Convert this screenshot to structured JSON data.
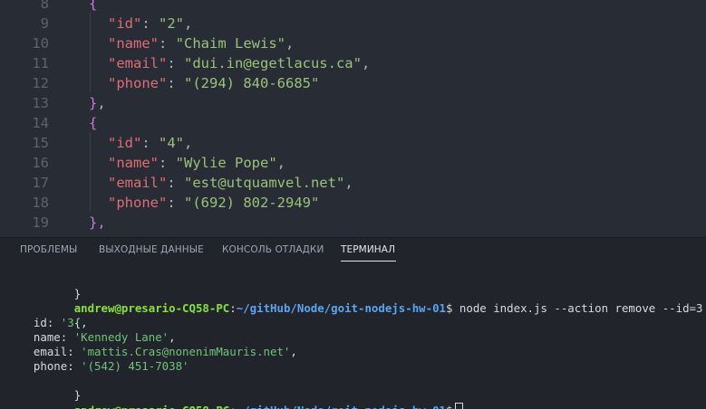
{
  "editor": {
    "lines": [
      {
        "num": "8",
        "tokens": [
          {
            "t": "{",
            "c": "brace"
          }
        ]
      },
      {
        "num": "9",
        "tokens": [
          {
            "t": "\"id\"",
            "c": "key"
          },
          {
            "t": ": ",
            "c": "punc"
          },
          {
            "t": "\"2\"",
            "c": "str"
          },
          {
            "t": ",",
            "c": "punc"
          }
        ]
      },
      {
        "num": "10",
        "tokens": [
          {
            "t": "\"name\"",
            "c": "key"
          },
          {
            "t": ": ",
            "c": "punc"
          },
          {
            "t": "\"Chaim Lewis\"",
            "c": "str"
          },
          {
            "t": ",",
            "c": "punc"
          }
        ]
      },
      {
        "num": "11",
        "tokens": [
          {
            "t": "\"email\"",
            "c": "key"
          },
          {
            "t": ": ",
            "c": "punc"
          },
          {
            "t": "\"dui.in@egetlacus.ca\"",
            "c": "str"
          },
          {
            "t": ",",
            "c": "punc"
          }
        ]
      },
      {
        "num": "12",
        "tokens": [
          {
            "t": "\"phone\"",
            "c": "key"
          },
          {
            "t": ": ",
            "c": "punc"
          },
          {
            "t": "\"(294) 840-6685\"",
            "c": "str"
          }
        ]
      },
      {
        "num": "13",
        "tokens": [
          {
            "t": "}",
            "c": "brace"
          },
          {
            "t": ",",
            "c": "punc"
          }
        ]
      },
      {
        "num": "14",
        "tokens": [
          {
            "t": "{",
            "c": "brace"
          }
        ]
      },
      {
        "num": "15",
        "tokens": [
          {
            "t": "\"id\"",
            "c": "key"
          },
          {
            "t": ": ",
            "c": "punc"
          },
          {
            "t": "\"4\"",
            "c": "str"
          },
          {
            "t": ",",
            "c": "punc"
          }
        ]
      },
      {
        "num": "16",
        "tokens": [
          {
            "t": "\"name\"",
            "c": "key"
          },
          {
            "t": ": ",
            "c": "punc"
          },
          {
            "t": "\"Wylie Pope\"",
            "c": "str"
          },
          {
            "t": ",",
            "c": "punc"
          }
        ]
      },
      {
        "num": "17",
        "tokens": [
          {
            "t": "\"email\"",
            "c": "key"
          },
          {
            "t": ": ",
            "c": "punc"
          },
          {
            "t": "\"est@utquamvel.net\"",
            "c": "str"
          },
          {
            "t": ",",
            "c": "punc"
          }
        ]
      },
      {
        "num": "18",
        "tokens": [
          {
            "t": "\"phone\"",
            "c": "key"
          },
          {
            "t": ": ",
            "c": "punc"
          },
          {
            "t": "\"(692) 802-2949\"",
            "c": "str"
          }
        ]
      },
      {
        "num": "19",
        "tokens": [
          {
            "t": "},",
            "c": "brace"
          }
        ]
      }
    ]
  },
  "panel": {
    "tabs": [
      {
        "label": "ПРОБЛЕМЫ",
        "active": false
      },
      {
        "label": "ВЫХОДНЫЕ ДАННЫЕ",
        "active": false
      },
      {
        "label": "КОНСОЛЬ ОТЛАДКИ",
        "active": false
      },
      {
        "label": "ТЕРМИНАЛ",
        "active": true
      }
    ]
  },
  "terminal": {
    "prompt_user": "andrew@presario-CQ58-PC",
    "prompt_sep": ":",
    "prompt_path": "~/gitHub/Node/goit-nodejs-hw-01",
    "prompt_dollar": "$",
    "command": " node index.js --action remove --id=3",
    "pre_line": "}",
    "open_brace": "{",
    "close_brace": "}",
    "record": [
      {
        "key": "  id: ",
        "value": "'3'",
        "suffix": ","
      },
      {
        "key": "  name: ",
        "value": "'Kennedy Lane'",
        "suffix": ","
      },
      {
        "key": "  email: ",
        "value": "'mattis.Cras@nonenimMauris.net'",
        "suffix": ","
      },
      {
        "key": "  phone: ",
        "value": "'(542) 451-7038'",
        "suffix": ""
      }
    ]
  },
  "colors": {
    "editor_bg": "#282c34",
    "panel_bg": "#21252b",
    "json_key": "#e06c75",
    "json_string": "#98c379",
    "json_brace": "#c678dd",
    "prompt_user": "#8ae234",
    "prompt_path": "#5aa4f0"
  }
}
